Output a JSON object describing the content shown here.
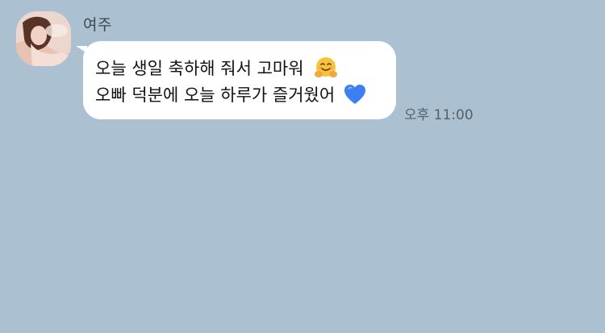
{
  "chat": {
    "message": {
      "sender": "여주",
      "lines": [
        "오늘 생일 축하해 줘서 고마워",
        "오빠 덕분에 오늘 하루가 즐거웠어"
      ],
      "emojis": [
        "hugging-face-emoji",
        "blue-heart-emoji"
      ],
      "time": "오후 11:00"
    }
  },
  "colors": {
    "background": "#abc1d1",
    "bubble": "#ffffff",
    "heart": "#3b7ff2",
    "hug_face": "#f8c23b"
  }
}
